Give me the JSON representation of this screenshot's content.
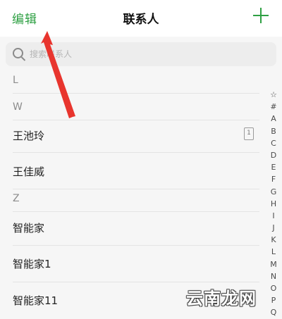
{
  "header": {
    "edit_label": "编辑",
    "title": "联系人"
  },
  "search": {
    "placeholder": "搜索联系人"
  },
  "sections": [
    {
      "letter": "L",
      "contacts": []
    },
    {
      "letter": "W",
      "contacts": [
        {
          "name": "王池玲",
          "sim": "1"
        },
        {
          "name": "王佳威"
        }
      ]
    },
    {
      "letter": "Z",
      "contacts": [
        {
          "name": "智能家"
        },
        {
          "name": "智能家1"
        },
        {
          "name": "智能家11"
        }
      ]
    }
  ],
  "index": [
    "☆",
    "#",
    "A",
    "B",
    "C",
    "D",
    "E",
    "F",
    "G",
    "H",
    "I",
    "J",
    "K",
    "L",
    "M",
    "N",
    "O",
    "P",
    "Q"
  ],
  "watermark": "云南龙网",
  "colors": {
    "accent": "#2ea043",
    "annotation": "#e8352e"
  },
  "icons": [
    "plus-icon",
    "search-icon",
    "sim-card-icon"
  ]
}
